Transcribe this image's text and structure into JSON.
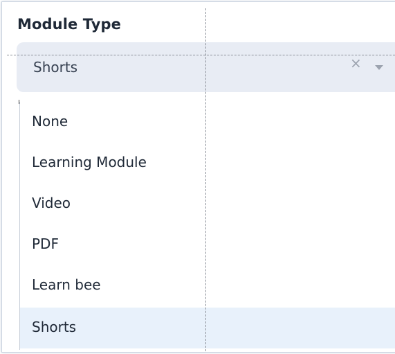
{
  "field": {
    "label": "Module Type",
    "selected_value": "Shorts",
    "clear_symbol": "×"
  },
  "icons": {
    "clear": "close-icon",
    "dropdown": "chevron-down-icon"
  },
  "dropdown": {
    "options": [
      {
        "label": "None",
        "selected": false
      },
      {
        "label": "Learning Module",
        "selected": false
      },
      {
        "label": "Video",
        "selected": false
      },
      {
        "label": "PDF",
        "selected": false
      },
      {
        "label": "Learn bee",
        "selected": false
      },
      {
        "label": "Shorts",
        "selected": true
      }
    ]
  },
  "colors": {
    "select_background": "#e8ecf4",
    "selected_option_background": "#e8f1fb",
    "text": "#1f2937"
  }
}
